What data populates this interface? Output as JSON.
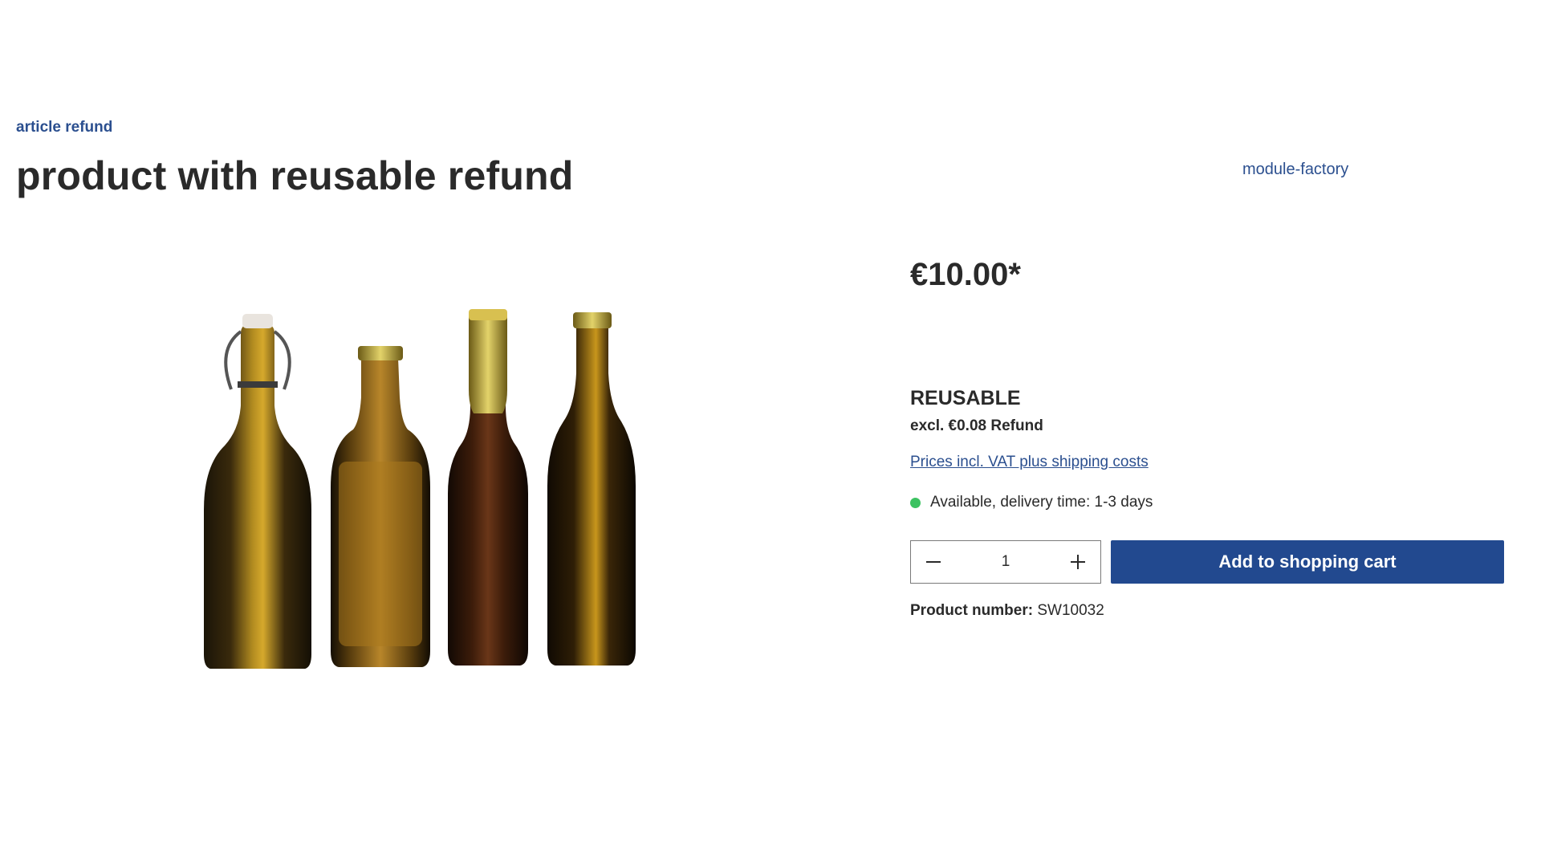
{
  "breadcrumb": {
    "category": "article refund"
  },
  "product": {
    "title": "product with reusable refund",
    "manufacturer": "module-factory",
    "image_alt": "four brown beer bottles",
    "price": "€10.00*",
    "deposit_type": "REUSABLE",
    "deposit_price": "excl. €0.08 Refund",
    "tax_link": "Prices incl. VAT plus shipping costs",
    "delivery": {
      "text": "Available, delivery time: 1-3 days",
      "status_color": "#3cc261"
    },
    "quantity": {
      "value": "1",
      "decrease_icon": "minus-icon",
      "increase_icon": "plus-icon"
    },
    "add_to_cart_label": "Add to shopping cart",
    "product_number_label": "Product number:",
    "product_number": "SW10032"
  },
  "colors": {
    "accent": "#22498f",
    "link": "#2b4f8f",
    "text": "#2a2a2a"
  }
}
